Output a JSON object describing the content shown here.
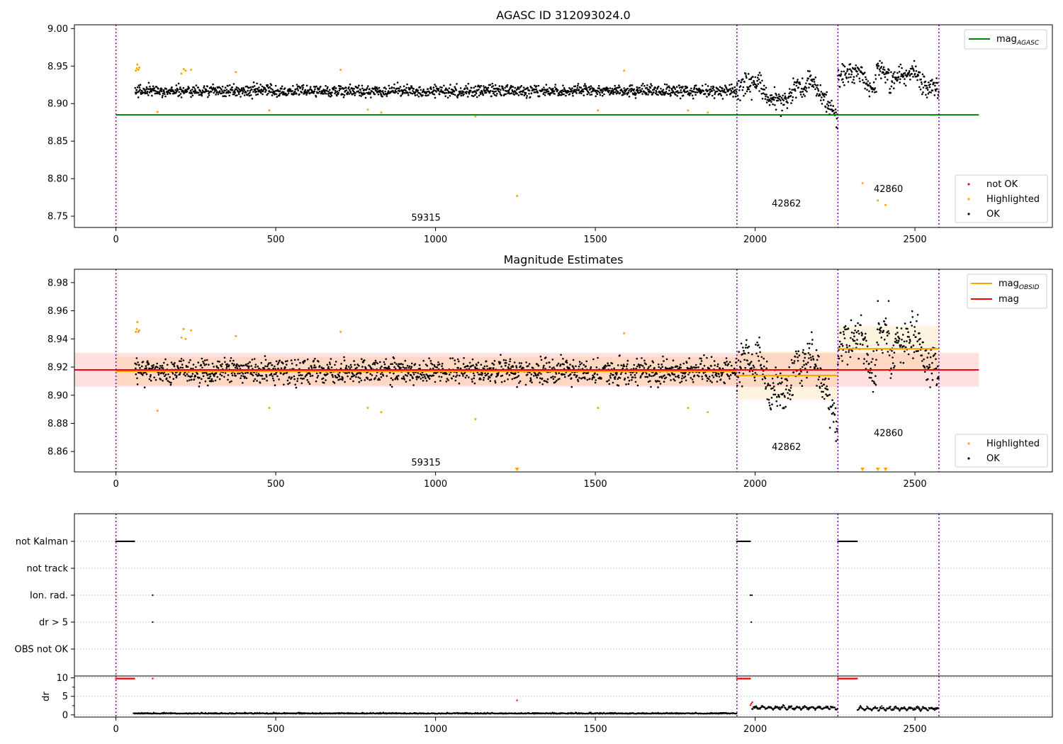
{
  "colors": {
    "ok": "#000000",
    "highlighted": "#ffa500",
    "not_ok": "#ff0000",
    "mag_agasc": "#008000",
    "mag_obsid": "#ffa500",
    "mag": "#ff0000",
    "obsid_boundary": "#7d00a8"
  },
  "chart_data": [
    {
      "type": "scatter",
      "title": "AGASC ID 312093024.0",
      "xlim": [
        -130,
        2930
      ],
      "ylim": [
        8.735,
        9.005
      ],
      "xticks": [
        0,
        500,
        1000,
        1500,
        2000,
        2500
      ],
      "xtick_labels": [
        "0",
        "500",
        "1000",
        "1500",
        "2000",
        "2500"
      ],
      "yticks": [
        8.75,
        8.8,
        8.85,
        8.9,
        8.95,
        9.0
      ],
      "ytick_labels": [
        "8.75",
        "8.80",
        "8.85",
        "8.90",
        "8.95",
        "9.00"
      ],
      "obsid_boundaries": [
        0,
        1943,
        2259,
        2575
      ],
      "obsid_labels": [
        {
          "text": "59315",
          "x": 970,
          "y": 8.744
        },
        {
          "text": "42862",
          "x": 2098,
          "y": 8.763
        },
        {
          "text": "42860",
          "x": 2417,
          "y": 8.782
        }
      ],
      "mag_agasc": {
        "value": 8.885,
        "x": [
          0,
          2700
        ]
      },
      "segments": [
        {
          "x": [
            60,
            1943
          ],
          "center": 8.917,
          "spread": 0.008
        },
        {
          "x": [
            1943,
            2259
          ],
          "center": 8.915,
          "spread": 0.015
        },
        {
          "x": [
            2259,
            2575
          ],
          "center": 8.93,
          "spread": 0.014
        }
      ],
      "highlighted": {
        "x": [
          62,
          65,
          67,
          70,
          73,
          130,
          205,
          212,
          218,
          235,
          375,
          480,
          703,
          788,
          830,
          1125,
          1255,
          1508,
          1590,
          1790,
          1852,
          2336,
          2384,
          2408
        ],
        "y": [
          8.944,
          8.947,
          8.952,
          8.945,
          8.948,
          8.889,
          8.94,
          8.946,
          8.944,
          8.945,
          8.942,
          8.891,
          8.945,
          8.892,
          8.888,
          8.883,
          8.777,
          8.891,
          8.944,
          8.891,
          8.888,
          8.794,
          8.771,
          8.765
        ]
      },
      "legend": {
        "top_right": [
          "mag"
        ],
        "top_right_subscript": [
          "AGASC"
        ],
        "bottom_right": [
          "not OK",
          "Highlighted",
          "OK"
        ]
      }
    },
    {
      "type": "scatter",
      "title": "Magnitude Estimates",
      "xlim": [
        -130,
        2930
      ],
      "ylim": [
        8.8455,
        8.9895
      ],
      "xticks": [
        0,
        500,
        1000,
        1500,
        2000,
        2500
      ],
      "xtick_labels": [
        "0",
        "500",
        "1000",
        "1500",
        "2000",
        "2500"
      ],
      "yticks": [
        8.86,
        8.88,
        8.9,
        8.92,
        8.94,
        8.96,
        8.98
      ],
      "ytick_labels": [
        "8.86",
        "8.88",
        "8.90",
        "8.92",
        "8.94",
        "8.96",
        "8.98"
      ],
      "obsid_boundaries": [
        0,
        1943,
        2259,
        2575
      ],
      "obsid_labels": [
        {
          "text": "59315",
          "x": 970,
          "y": 8.85
        },
        {
          "text": "42862",
          "x": 2098,
          "y": 8.861
        },
        {
          "text": "42860",
          "x": 2417,
          "y": 8.871
        }
      ],
      "mag": {
        "value": 8.918,
        "band": [
          8.906,
          8.93
        ],
        "x": [
          -130,
          2700
        ]
      },
      "mag_obsid": [
        {
          "x": [
            0,
            1943
          ],
          "value": 8.917,
          "band": [
            8.907,
            8.927
          ]
        },
        {
          "x": [
            1943,
            2259
          ],
          "value": 8.914,
          "band": [
            8.897,
            8.931
          ]
        },
        {
          "x": [
            2259,
            2575
          ],
          "value": 8.933,
          "band": [
            8.917,
            8.949
          ]
        }
      ],
      "segments": [
        {
          "x": [
            60,
            1943
          ],
          "center": 8.917,
          "spread": 0.009
        },
        {
          "x": [
            1943,
            2259
          ],
          "center": 8.915,
          "spread": 0.016
        },
        {
          "x": [
            2259,
            2575
          ],
          "center": 8.93,
          "spread": 0.016
        }
      ],
      "highlighted": {
        "x": [
          62,
          65,
          67,
          70,
          73,
          130,
          205,
          212,
          218,
          235,
          375,
          480,
          703,
          788,
          830,
          1125,
          1508,
          1590,
          1790,
          1852
        ],
        "y": [
          8.945,
          8.947,
          8.952,
          8.945,
          8.946,
          8.889,
          8.941,
          8.947,
          8.94,
          8.946,
          8.942,
          8.891,
          8.945,
          8.891,
          8.888,
          8.883,
          8.891,
          8.944,
          8.891,
          8.888
        ]
      },
      "offscale_markers": {
        "x": [
          1255,
          2336,
          2384,
          2408
        ]
      },
      "legend": {
        "top_right": [
          "mag",
          "mag"
        ],
        "top_right_subscript": [
          "OBSID",
          ""
        ],
        "bottom_right": [
          "Highlighted",
          "OK"
        ]
      }
    },
    {
      "type": "scatter",
      "title": "",
      "xlim": [
        -130,
        2930
      ],
      "flag_rows": [
        "not Kalman",
        "not track",
        "Ion. rad.",
        "dr > 5",
        "OBS not OK"
      ],
      "flags": {
        "not Kalman": {
          "ranges": [
            [
              0,
              58
            ],
            [
              1943,
              1985
            ],
            [
              2259,
              2320
            ]
          ]
        },
        "not track": {
          "ranges": []
        },
        "Ion. rad.": {
          "points": [
            115,
            1985,
            1990
          ]
        },
        "dr > 5": {
          "points": [
            115,
            1988
          ]
        },
        "OBS not OK": {
          "points": []
        }
      }
    },
    {
      "type": "scatter",
      "ylabel": "dr",
      "xlim": [
        -130,
        2930
      ],
      "ylim": [
        -0.6,
        10.5
      ],
      "xticks": [
        0,
        500,
        1000,
        1500,
        2000,
        2500
      ],
      "xtick_labels": [
        "0",
        "500",
        "1000",
        "1500",
        "2000",
        "2500"
      ],
      "yticks": [
        0,
        5,
        10
      ],
      "ytick_labels": [
        "0",
        "5",
        "10"
      ],
      "red_top": {
        "ranges": [
          [
            0,
            58
          ],
          [
            1943,
            1985
          ],
          [
            2259,
            2320
          ]
        ],
        "points": [
          115
        ],
        "value": 9.8
      },
      "red_extra": {
        "x": [
          1255,
          1985,
          1988,
          1991
        ],
        "y": [
          3.9,
          2.6,
          3.0,
          3.4
        ]
      },
      "dr_segments": [
        {
          "x": [
            55,
            1943
          ],
          "level": 0.3
        },
        {
          "x": [
            1990,
            2259
          ],
          "level": 1.2
        },
        {
          "x": [
            2320,
            2575
          ],
          "level": 1.0
        }
      ]
    }
  ]
}
